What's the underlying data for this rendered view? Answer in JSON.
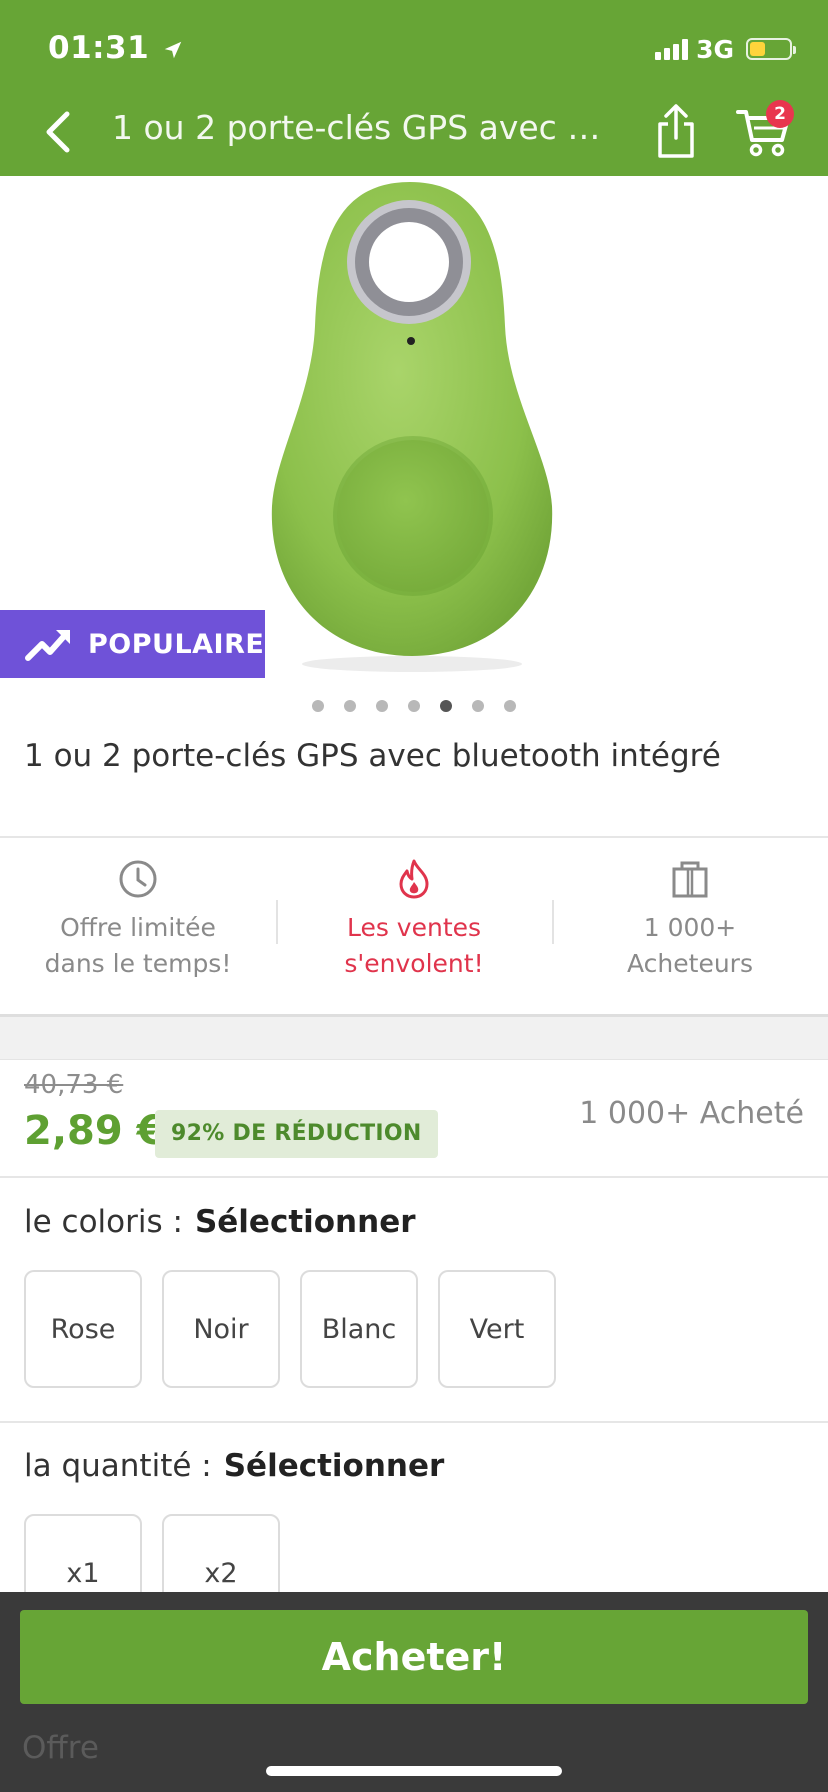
{
  "status_bar": {
    "time": "01:31",
    "network": "3G",
    "battery_level": 0.4
  },
  "header": {
    "title": "1 ou 2 porte-clés GPS avec bluetooth intégré",
    "cart_count": "2",
    "background": "#67a536"
  },
  "gallery": {
    "badge_label": "POPULAIRE",
    "badge_color": "#6f52d8",
    "dot_count": 7,
    "active_index": 4
  },
  "product": {
    "title": "1 ou 2 porte-clés GPS avec bluetooth intégré"
  },
  "features": [
    {
      "icon": "clock-icon",
      "line1": "Offre limitée",
      "line2": "dans le temps!"
    },
    {
      "icon": "flame-icon",
      "line1": "Les ventes",
      "line2": "s'envolent!"
    },
    {
      "icon": "gift-bag-icon",
      "line1": "1 000+",
      "line2": "Acheteurs"
    }
  ],
  "pricing": {
    "old_price": "40,73 €",
    "price": "2,89 €",
    "discount": "92% DE RÉDUCTION",
    "bought": "1 000+ Acheté",
    "price_color": "#5ea032"
  },
  "color_option": {
    "label": "le coloris :",
    "value": "Sélectionner",
    "choices": [
      "Rose",
      "Noir",
      "Blanc",
      "Vert"
    ]
  },
  "quantity_option": {
    "label": "la quantité :",
    "value": "Sélectionner",
    "choices": [
      "x1",
      "x2"
    ]
  },
  "footer": {
    "buy_label": "Acheter!",
    "offer_text": "Offre"
  }
}
